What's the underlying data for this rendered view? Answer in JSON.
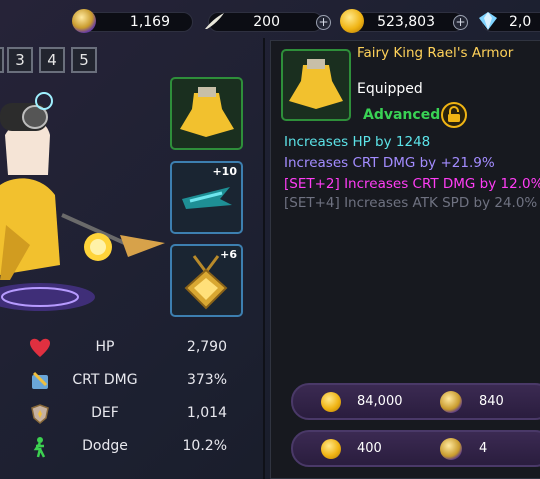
{
  "topbar": {
    "currency1_value": "1,169",
    "currency2_value": "200",
    "currency3_value": "523,803",
    "currency4_value": "2,0",
    "plus": "+"
  },
  "tabs": [
    "3",
    "4",
    "5"
  ],
  "equipment_slots": {
    "weapon_level": "+10",
    "accessory_level": "+6"
  },
  "stats": [
    {
      "name": "HP",
      "value": "2,790",
      "icon": "heart-icon"
    },
    {
      "name": "CRT DMG",
      "value": "373%",
      "icon": "crit-damage-icon"
    },
    {
      "name": "DEF",
      "value": "1,014",
      "icon": "shield-icon"
    },
    {
      "name": "Dodge",
      "value": "10.2%",
      "icon": "dodge-icon"
    }
  ],
  "item_panel": {
    "title": "Fairy King Rael's Armor",
    "status": "Equipped",
    "grade": "Advanced",
    "effects": [
      {
        "text": "Increases HP by 1248",
        "color": "#5ce3e8"
      },
      {
        "text": "Increases CRT DMG by +21.9%",
        "color": "#a38cff"
      },
      {
        "text": "[SET+2] Increases CRT DMG by 12.0%",
        "color": "#ff3df5"
      },
      {
        "text": "[SET+4] Increases ATK SPD by 24.0%",
        "color": "#6f7281"
      }
    ]
  },
  "actions": [
    {
      "gold": "84,000",
      "chests": "840"
    },
    {
      "gold": "400",
      "chests": "4"
    }
  ],
  "colors": {
    "accent_gold": "#ffd25a",
    "grade_green": "#39d254",
    "button_purple": "#3b2a52"
  }
}
